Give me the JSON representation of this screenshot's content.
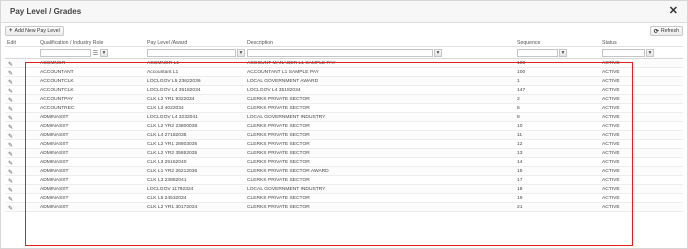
{
  "window": {
    "title": "Pay Level / Grades",
    "close_glyph": "✕"
  },
  "toolbar": {
    "add_label": "Add New Pay Level",
    "add_icon": "+",
    "refresh_label": "Refresh",
    "refresh_icon": "⟳"
  },
  "columns": {
    "edit": "Edit",
    "qualification": "Qualification / Industry Role",
    "pay_level": "Pay Level /Award",
    "description": "Description",
    "sequence": "Sequence",
    "status": "Status"
  },
  "icons": {
    "filter": "filter-icon",
    "sort": "sort-icon",
    "edit": "pencil-icon"
  },
  "accent_color": "#e0201c",
  "rows": [
    {
      "qualification": "ACCMNGR",
      "pay_level": "ACCMNGR L1",
      "description": "ACCOUNT MANAGER L1 SAMPLE PAY",
      "sequence": "100",
      "status": "ACTIVE"
    },
    {
      "qualification": "ACCOUNTANT",
      "pay_level": "Accountant L1",
      "description": "ACCOUNTANT L1 SAMPLE PAY",
      "sequence": "100",
      "status": "ACTIVE"
    },
    {
      "qualification": "ACCOUNTCLK",
      "pay_level": "LOCLGOV L5 23622036",
      "description": "LOCAL GOVERNMENT AWARD",
      "sequence": "1",
      "status": "ACTIVE"
    },
    {
      "qualification": "ACCOUNTCLK",
      "pay_level": "LOCLGOV L4 35182034",
      "description": "LOCLGOV L4 35182034",
      "sequence": "147",
      "status": "ACTIVE"
    },
    {
      "qualification": "ACCOUNTPAY",
      "pay_level": "CLK L2 YR1 9322034",
      "description": "CLERKS PRIVATE SECTOR",
      "sequence": "2",
      "status": "ACTIVE"
    },
    {
      "qualification": "ACCOUNTREC",
      "pay_level": "CLK L3 4022034",
      "description": "CLERKS PRIVATE SECTOR",
      "sequence": "6",
      "status": "ACTIVE"
    },
    {
      "qualification": "ADMINASST",
      "pay_level": "LOCLGOV L4 3232041",
      "description": "LOCAL GOVERNMENT INDUSTRY",
      "sequence": "8",
      "status": "ACTIVE"
    },
    {
      "qualification": "ADMINASST",
      "pay_level": "CLK L2 YR2 23800038",
      "description": "CLERKS PRIVATE SECTOR",
      "sequence": "10",
      "status": "ACTIVE"
    },
    {
      "qualification": "ADMINASST",
      "pay_level": "CLK L4 27182035",
      "description": "CLERKS PRIVATE SECTOR",
      "sequence": "11",
      "status": "ACTIVE"
    },
    {
      "qualification": "ADMINASST",
      "pay_level": "CLK L2 YR1 28803035",
      "description": "CLERKS PRIVATE SECTOR",
      "sequence": "12",
      "status": "ACTIVE"
    },
    {
      "qualification": "ADMINASST",
      "pay_level": "CLK L2 YR2 35852035",
      "description": "CLERKS PRIVATE SECTOR",
      "sequence": "13",
      "status": "ACTIVE"
    },
    {
      "qualification": "ADMINASST",
      "pay_level": "CLK L3 25162040",
      "description": "CLERKS PRIVATE SECTOR",
      "sequence": "14",
      "status": "ACTIVE"
    },
    {
      "qualification": "ADMINASST",
      "pay_level": "CLK L1 YR2 26212036",
      "description": "CLERKS PRIVATE SECTOR AWARD",
      "sequence": "15",
      "status": "ACTIVE"
    },
    {
      "qualification": "ADMINASST",
      "pay_level": "CLK L3 23882041",
      "description": "CLERKS PRIVATE SECTOR",
      "sequence": "17",
      "status": "ACTIVE"
    },
    {
      "qualification": "ADMINASST",
      "pay_level": "LOCLGOV 11792324",
      "description": "LOCAL GOVERNMENT INDUSTRY",
      "sequence": "18",
      "status": "ACTIVE"
    },
    {
      "qualification": "ADMINASST",
      "pay_level": "CLK L5 24532034",
      "description": "CLERKS PRIVATE SECTOR",
      "sequence": "19",
      "status": "ACTIVE"
    },
    {
      "qualification": "ADMINASST",
      "pay_level": "CLK L2 YR1 30172034",
      "description": "CLERKS PRIVATE SECTOR",
      "sequence": "21",
      "status": "ACTIVE"
    }
  ]
}
